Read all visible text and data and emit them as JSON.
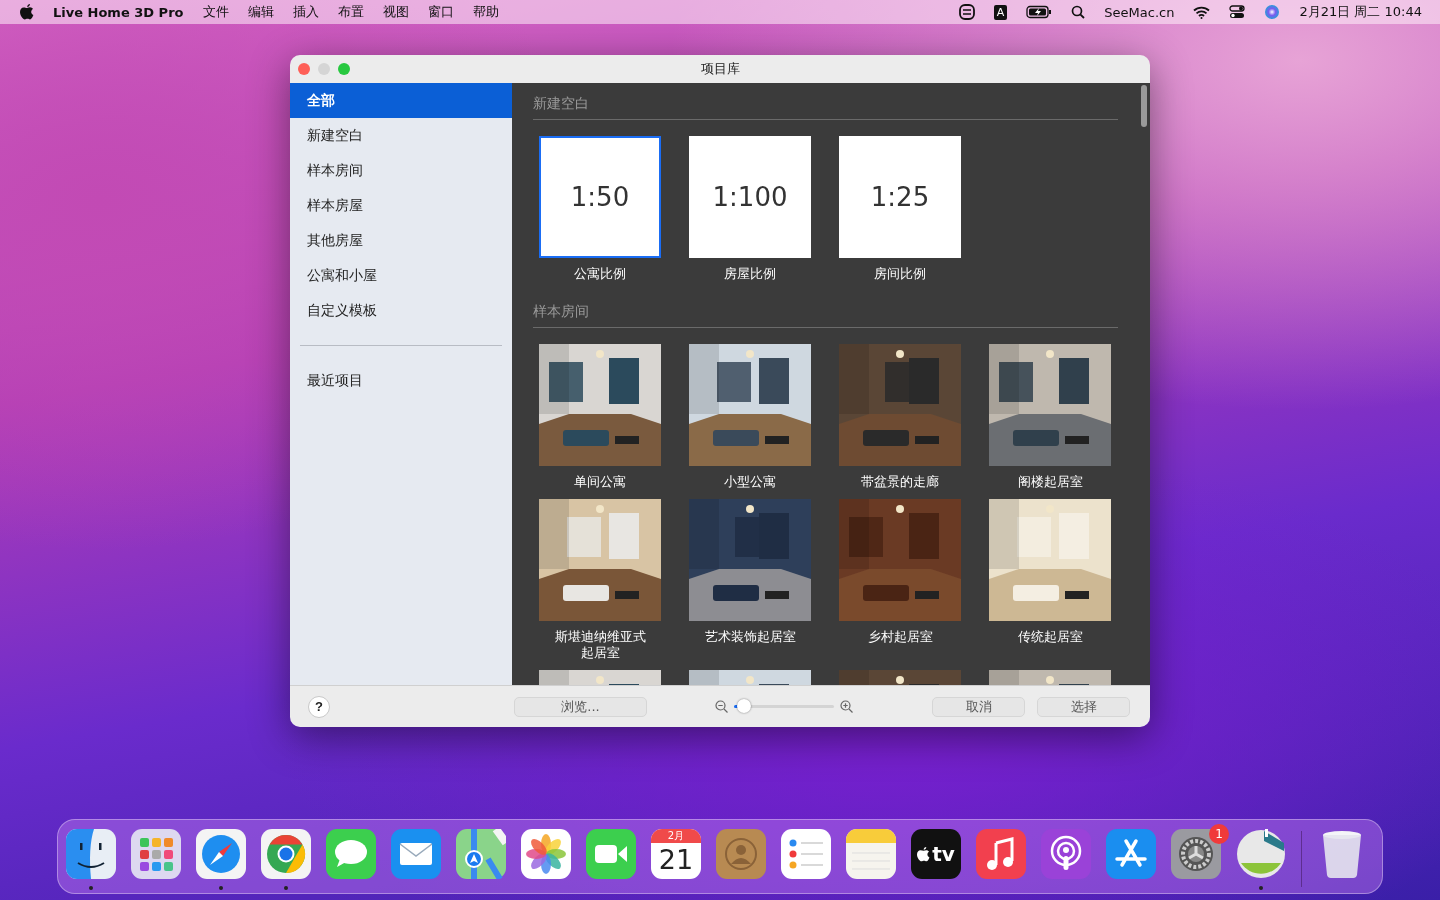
{
  "menu_bar": {
    "app_name": "Live Home 3D Pro",
    "menus": [
      "文件",
      "编辑",
      "插入",
      "布置",
      "视图",
      "窗口",
      "帮助"
    ],
    "input_source": "A",
    "site": "SeeMac.cn",
    "clock": "2月21日 周二 10:44"
  },
  "window": {
    "title": "项目库"
  },
  "sidebar": {
    "items": [
      {
        "label": "全部",
        "selected": true
      },
      {
        "label": "新建空白",
        "selected": false
      },
      {
        "label": "样本房间",
        "selected": false
      },
      {
        "label": "样本房屋",
        "selected": false
      },
      {
        "label": "其他房屋",
        "selected": false
      },
      {
        "label": "公寓和小屋",
        "selected": false
      },
      {
        "label": "自定义模板",
        "selected": false
      }
    ],
    "recent": {
      "label": "最近项目",
      "selected": false
    }
  },
  "sections": [
    {
      "title": "新建空白",
      "items": [
        {
          "kind": "scale",
          "scale": "1:50",
          "label": "公寓比例",
          "selected": true
        },
        {
          "kind": "scale",
          "scale": "1:100",
          "label": "房屋比例",
          "selected": false
        },
        {
          "kind": "scale",
          "scale": "1:25",
          "label": "房间比例",
          "selected": false
        }
      ]
    },
    {
      "title": "样本房间",
      "items": [
        {
          "kind": "picture",
          "label": "单间公寓",
          "selected": false
        },
        {
          "kind": "picture",
          "label": "小型公寓",
          "selected": false
        },
        {
          "kind": "picture",
          "label": "带盆景的走廊",
          "selected": false
        },
        {
          "kind": "picture",
          "label": "阁楼起居室",
          "selected": false
        },
        {
          "kind": "picture",
          "label": "斯堪迪纳维亚式起居室",
          "selected": false
        },
        {
          "kind": "picture",
          "label": "艺术装饰起居室",
          "selected": false
        },
        {
          "kind": "picture",
          "label": "乡村起居室",
          "selected": false
        },
        {
          "kind": "picture",
          "label": "传统起居室",
          "selected": false
        },
        {
          "kind": "picture",
          "selected": false
        },
        {
          "kind": "picture",
          "selected": false
        },
        {
          "kind": "picture",
          "selected": false
        },
        {
          "kind": "picture",
          "selected": false
        }
      ]
    }
  ],
  "footer": {
    "help": "?",
    "browse": "浏览...",
    "zoom": {
      "level": 0.1
    },
    "cancel": "取消",
    "select": "选择"
  },
  "dock": [
    {
      "kind": "finder",
      "running": true
    },
    {
      "kind": "launchpad",
      "running": false
    },
    {
      "kind": "safari",
      "running": true
    },
    {
      "kind": "chrome",
      "running": true
    },
    {
      "kind": "messages",
      "running": false
    },
    {
      "kind": "mail",
      "running": false
    },
    {
      "kind": "maps",
      "running": false
    },
    {
      "kind": "photos",
      "running": false
    },
    {
      "kind": "facetime",
      "running": false
    },
    {
      "kind": "calendar",
      "running": false,
      "month": "2月",
      "day": "21"
    },
    {
      "kind": "contacts",
      "running": false
    },
    {
      "kind": "reminders",
      "running": false
    },
    {
      "kind": "notes",
      "running": false
    },
    {
      "kind": "tv",
      "running": false,
      "label": "tv"
    },
    {
      "kind": "music",
      "running": false
    },
    {
      "kind": "podcasts",
      "running": false
    },
    {
      "kind": "appstore",
      "running": false
    },
    {
      "kind": "settings",
      "running": false,
      "badge": "1"
    },
    {
      "kind": "house",
      "running": true
    },
    {
      "kind": "separator"
    },
    {
      "kind": "trash",
      "running": false
    }
  ]
}
